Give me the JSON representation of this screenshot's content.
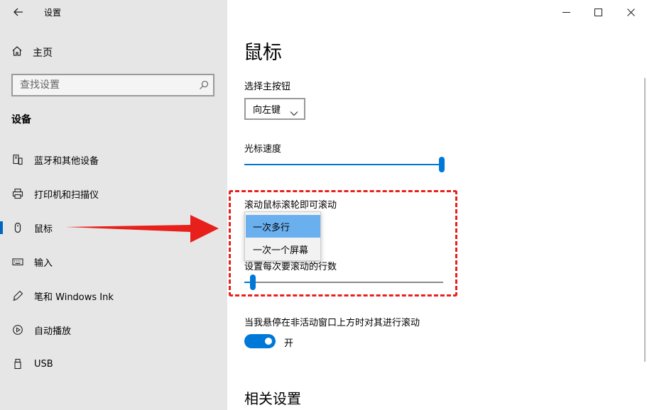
{
  "window": {
    "title": "设置"
  },
  "sidebar": {
    "home_label": "主页",
    "search_placeholder": "查找设置",
    "section_title": "设备",
    "items": [
      {
        "label": "蓝牙和其他设备",
        "icon": "bluetooth-devices-icon"
      },
      {
        "label": "打印机和扫描仪",
        "icon": "printer-icon"
      },
      {
        "label": "鼠标",
        "icon": "mouse-icon",
        "active": true
      },
      {
        "label": "输入",
        "icon": "keyboard-icon"
      },
      {
        "label": "笔和 Windows Ink",
        "icon": "pen-icon"
      },
      {
        "label": "自动播放",
        "icon": "autoplay-icon"
      },
      {
        "label": "USB",
        "icon": "usb-icon"
      }
    ]
  },
  "main": {
    "page_title": "鼠标",
    "primary_button": {
      "label": "选择主按钮",
      "value": "向左键"
    },
    "cursor_speed": {
      "label": "光标速度",
      "value_fraction": 1.0
    },
    "scroll_mode": {
      "label": "滚动鼠标滚轮即可滚动",
      "options": [
        "一次多行",
        "一次一个屏幕"
      ],
      "selected": "一次多行"
    },
    "scroll_lines": {
      "label": "设置每次要滚动的行数",
      "value_fraction": 0.03
    },
    "inactive_scroll": {
      "label": "当我悬停在非活动窗口上方时对其进行滚动",
      "state": "开"
    },
    "related_settings_title": "相关设置"
  },
  "colors": {
    "accent": "#0078d7",
    "annotation": "#e8201c",
    "sidebar_bg": "#e6e6e6"
  }
}
